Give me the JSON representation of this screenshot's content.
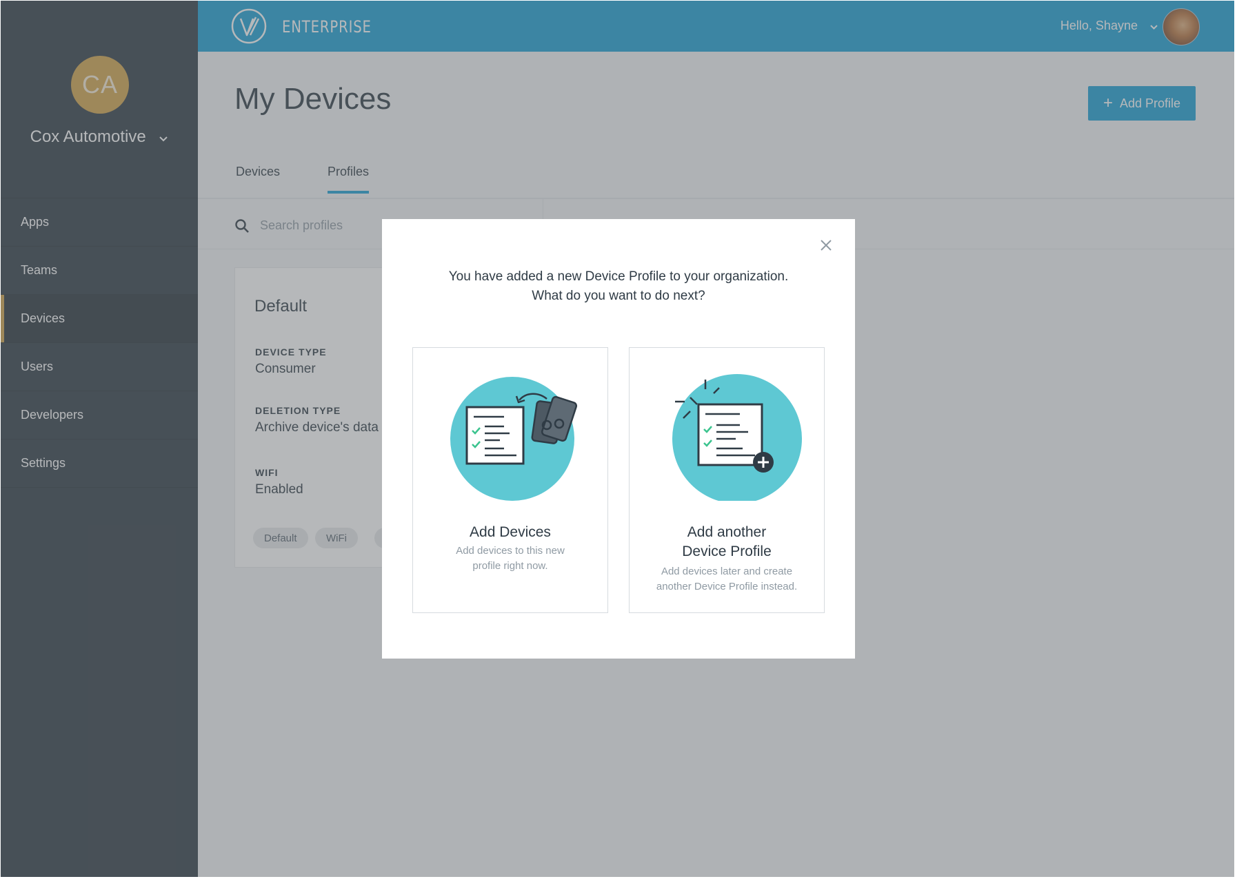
{
  "org": {
    "initials": "CA",
    "name": "Cox Automotive"
  },
  "nav": {
    "items": [
      {
        "label": "Apps"
      },
      {
        "label": "Teams"
      },
      {
        "label": "Devices"
      },
      {
        "label": "Users"
      },
      {
        "label": "Developers"
      },
      {
        "label": "Settings"
      }
    ],
    "active": "Devices"
  },
  "topbar": {
    "brand": "ENTERPRISE",
    "greeting": "Hello, Shayne"
  },
  "page": {
    "title": "My Devices",
    "add_profile_label": "Add Profile"
  },
  "tabs": [
    {
      "label": "Devices"
    },
    {
      "label": "Profiles"
    }
  ],
  "active_tab": "Profiles",
  "search": {
    "placeholder": "Search profiles"
  },
  "profile_card": {
    "title": "Default",
    "device_type_label": "DEVICE TYPE",
    "device_type_value": "Consumer",
    "deletion_type_label": "DELETION TYPE",
    "deletion_type_value": "Archive device's data",
    "wifi_label": "WIFI",
    "wifi_value": "Enabled",
    "chips": [
      {
        "label": "Default"
      },
      {
        "label": "WiFi"
      }
    ]
  },
  "modal": {
    "message_line1": "You have added a new Device Profile to your organization.",
    "message_line2": "What do you want to do next?",
    "options": [
      {
        "title_line1": "Add Devices",
        "desc_line1": "Add devices to this new",
        "desc_line2": "profile right now."
      },
      {
        "title_line1": "Add another",
        "title_line2": "Device Profile",
        "desc_line1": "Add devices later and create",
        "desc_line2": "another Device Profile instead."
      }
    ]
  },
  "colors": {
    "sidebar": "#2f3b45",
    "accent_gold": "#d1a44b",
    "brand_blue": "#1a9fd3",
    "illustration_teal": "#5ec8d3",
    "check_green": "#3cc48f"
  },
  "icons": [
    "vmware-logo-icon",
    "chevron-down-icon",
    "plus-icon",
    "search-icon",
    "close-icon",
    "checklist-icon",
    "devices-icon",
    "add-circle-icon"
  ]
}
